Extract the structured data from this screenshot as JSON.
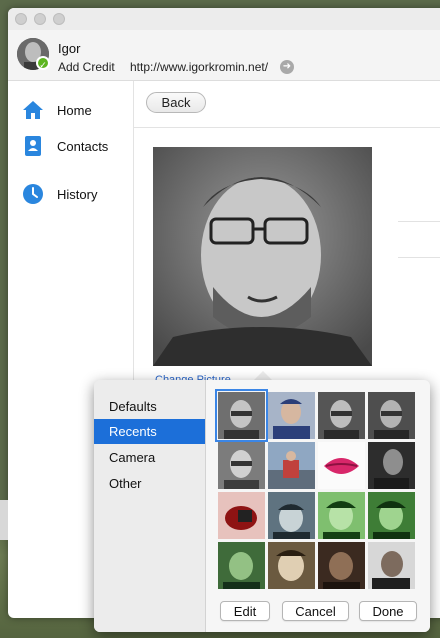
{
  "user": {
    "name": "Igor",
    "add_credit": "Add Credit",
    "url": "http://www.igorkromin.net/"
  },
  "sidebar": {
    "items": [
      {
        "label": "Home",
        "icon": "home-icon"
      },
      {
        "label": "Contacts",
        "icon": "contacts-icon"
      },
      {
        "label": "History",
        "icon": "history-icon"
      }
    ]
  },
  "main": {
    "back_label": "Back",
    "change_picture": "Change Picture"
  },
  "picker": {
    "categories": [
      "Defaults",
      "Recents",
      "Camera",
      "Other"
    ],
    "selected_category": "Recents",
    "buttons": {
      "edit": "Edit",
      "cancel": "Cancel",
      "done": "Done"
    }
  },
  "colors": {
    "accent": "#1c6fd9",
    "status": "#5cb51f",
    "nav_icon": "#2a86de"
  }
}
